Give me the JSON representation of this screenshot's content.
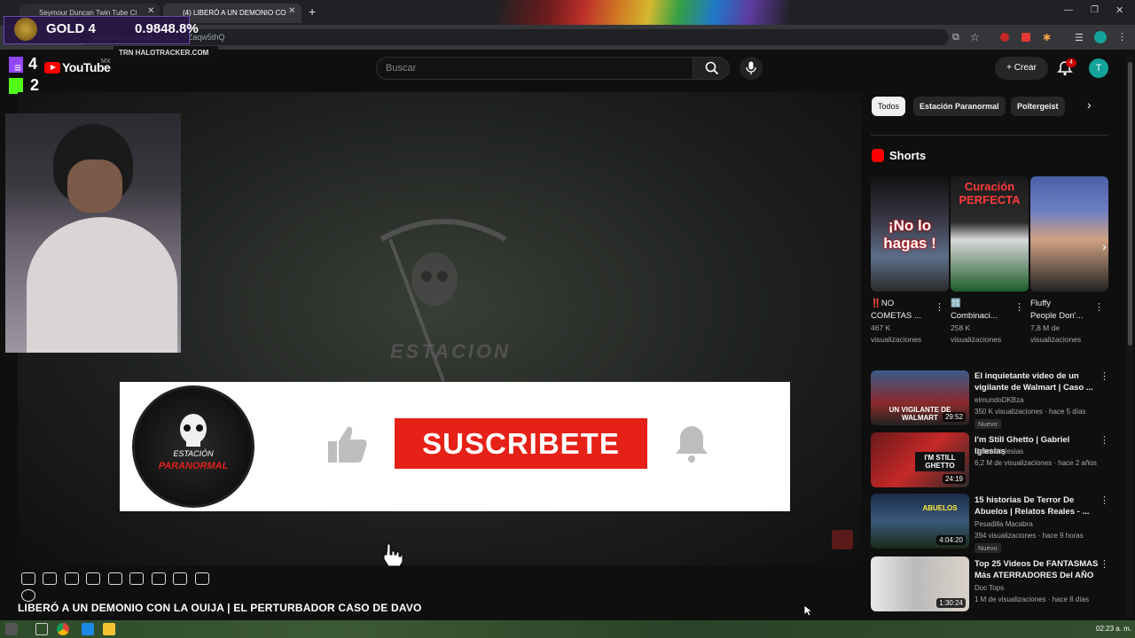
{
  "browser": {
    "tabs": [
      {
        "label": "Seymour Duncan Twin Tube Cl"
      },
      {
        "label": "(4) LIBERÓ A UN DEMONIO CO"
      }
    ],
    "new_tab": "+",
    "url": "youtube.com/watch?v=1_TZaqw5thQ"
  },
  "overlay": {
    "rank_label": "GOLD 4",
    "rank_value": "0.9848.8%",
    "tracker": "TRN  HALOTRACKER.COM",
    "twitch_count": "4",
    "kick_count": "2"
  },
  "youtube": {
    "logo": "YouTube",
    "region": "MX",
    "search_placeholder": "Buscar",
    "create_label": "Crear",
    "notif_count": "4",
    "avatar_letter": "T"
  },
  "player": {
    "watermark": "ESTACION",
    "logo_line1": "ESTACIÓN",
    "logo_line2": "PARANORMAL",
    "subscribe_label": "SUSCRIBETE"
  },
  "video_title": "LIBERÓ A UN DEMONIO CON LA OUIJA | EL PERTURBADOR CASO DE DAVO",
  "chips": [
    "Todos",
    "Estación Paranormal",
    "Poltergeist"
  ],
  "shorts": {
    "title": "Shorts",
    "items": [
      {
        "overlay": "¡No lo hagas !",
        "title1": "‼️NO",
        "title2": "COMETAS ...",
        "views1": "467 K",
        "views2": "visualizaciones"
      },
      {
        "overlay": "Curación PERFECTA",
        "title1": "🔠",
        "title2": "Combinaci...",
        "views1": "258 K",
        "views2": "visualizaciones"
      },
      {
        "overlay": "",
        "title1": "Fluffy",
        "title2": "People Don'...",
        "views1": "7,8 M de",
        "views2": "visualizaciones"
      }
    ]
  },
  "videos": [
    {
      "title": "El inquietante video de un vigilante de Walmart | Caso ...",
      "channel": "elmundoDKBza",
      "stats": "350 K visualizaciones · hace 5 días",
      "duration": "29:52",
      "badge": "Nuevo",
      "thumb_text": "UN VIGILANTE DE WALMART"
    },
    {
      "title": "I'm Still Ghetto | Gabriel Iglesias",
      "channel": "Gabriel Iglesias",
      "stats": "6,2 M de visualizaciones · hace 2 años",
      "duration": "24:19",
      "badge": "",
      "thumb_text": "I'M STILL GHETTO"
    },
    {
      "title": "15 historias De Terror De Abuelos | Relatos Reales - ...",
      "channel": "Pesadilla Macabra",
      "stats": "394 visualizaciones · hace 9 horas",
      "duration": "4:04:20",
      "badge": "Nuevo",
      "thumb_text": "ABUELOS"
    },
    {
      "title": "Top 25 Videos De FANTASMAS Más ATERRADORES Del AÑO",
      "channel": "Doc Tops",
      "stats": "1 M de visualizaciones · hace 8 días",
      "duration": "1:30:24",
      "badge": "",
      "thumb_text": ""
    }
  ],
  "taskbar": {
    "clock": "02:23 a. m."
  },
  "colors": {
    "youtube_red": "#ff0000",
    "subscribe_red": "#e62117",
    "background": "#0f0f0f"
  }
}
